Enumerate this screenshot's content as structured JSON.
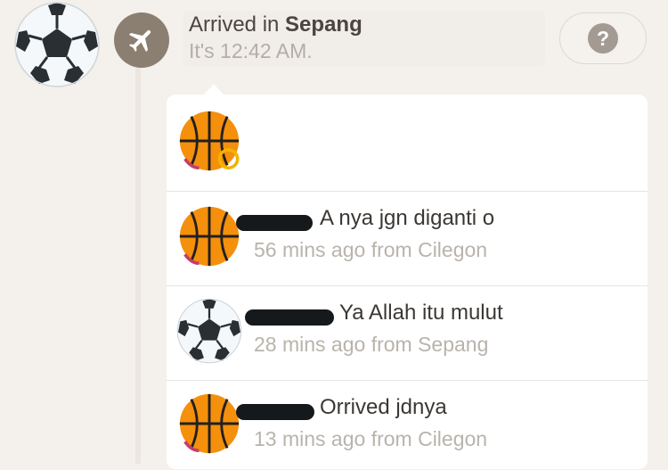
{
  "event": {
    "title_prefix": "Arrived in",
    "title_place": "Sepang",
    "time_text": "It's 12:42 AM.",
    "icon": "airplane-icon",
    "help_symbol": "?"
  },
  "user_avatar": "soccer-ball-avatar",
  "reaction": {
    "avatar": "basketball-avatar"
  },
  "comments": [
    {
      "avatar": "basketball-avatar",
      "text": "A nya jgn diganti o",
      "meta": "56 mins ago from Cilegon"
    },
    {
      "avatar": "soccer-ball-avatar",
      "text": "Ya Allah itu mulut",
      "meta": "28 mins ago from Sepang"
    },
    {
      "avatar": "basketball-avatar",
      "text": "Orrived jdnya",
      "meta": "13 mins ago from Cilegon"
    }
  ],
  "colors": {
    "background": "#f4f0eb",
    "icon_circle": "#8b7f72",
    "basketball": "#f4900c",
    "text_dark": "#3b3834",
    "text_muted": "#b9b3ac"
  }
}
